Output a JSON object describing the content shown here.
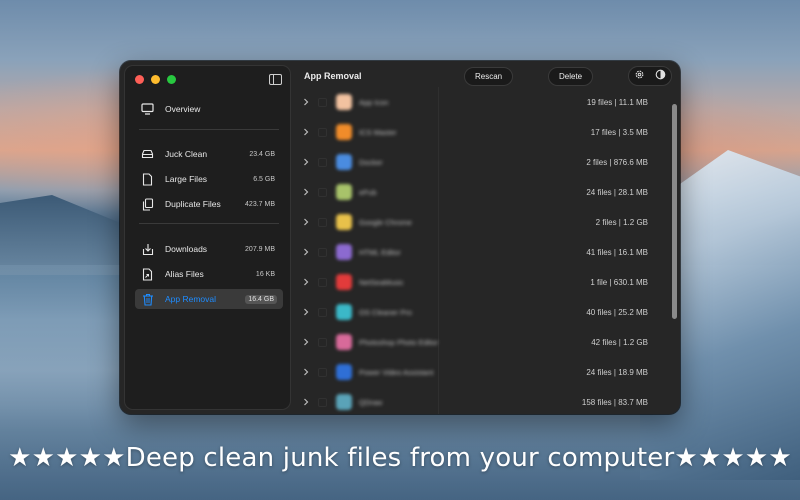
{
  "colors": {
    "accent": "#1e8cff",
    "window_bg": "#262626",
    "sidebar_bg": "#1e1e1e"
  },
  "window": {
    "traffic_lights": [
      "close",
      "minimize",
      "maximize"
    ],
    "sidebar": {
      "toggle_icon": "sidebar-toggle-icon",
      "items": [
        {
          "label": "Overview",
          "icon": "monitor-icon",
          "size": ""
        },
        {
          "label": "Juck Clean",
          "icon": "drive-icon",
          "size": "23.4 GB"
        },
        {
          "label": "Large Files",
          "icon": "document-icon",
          "size": "6.5 GB"
        },
        {
          "label": "Duplicate Files",
          "icon": "duplicate-icon",
          "size": "423.7 MB"
        },
        {
          "label": "Downloads",
          "icon": "download-icon",
          "size": "207.9 MB"
        },
        {
          "label": "Alias Files",
          "icon": "alias-file-icon",
          "size": "16 KB"
        },
        {
          "label": "App Removal",
          "icon": "trash-icon",
          "size": "16.4 GB",
          "selected": true
        }
      ]
    },
    "main": {
      "title": "App Removal",
      "rescan_label": "Rescan",
      "delete_label": "Delete",
      "tool_icons": [
        "gear-icon",
        "contrast-icon"
      ],
      "rows": [
        {
          "name": "App Icon",
          "info": "19 files | 11.1 MB",
          "icon_color": "#f2c2a0"
        },
        {
          "name": "ICS Master",
          "info": "17 files | 3.5 MB",
          "icon_color": "#f08c2a"
        },
        {
          "name": "Docker",
          "info": "2 files | 876.6 MB",
          "icon_color": "#4a8ce0"
        },
        {
          "name": "ePub",
          "info": "24 files | 28.1 MB",
          "icon_color": "#a8c36a"
        },
        {
          "name": "Google Chrome",
          "info": "2 files | 1.2 GB",
          "icon_color": "#e8c14a"
        },
        {
          "name": "HTML Editor",
          "info": "41 files | 16.1 MB",
          "icon_color": "#8c6ad0"
        },
        {
          "name": "NetSeaMusic",
          "info": "1 file | 630.1 MB",
          "icon_color": "#e23b3b"
        },
        {
          "name": "OS Cleaner Pro",
          "info": "40 files | 25.2 MB",
          "icon_color": "#3bb8c8"
        },
        {
          "name": "Photoshop Photo Editor",
          "info": "42 files | 1.2 GB",
          "icon_color": "#d86a9a"
        },
        {
          "name": "Power Video Assistant",
          "info": "24 files | 18.9 MB",
          "icon_color": "#2f6fd6"
        },
        {
          "name": "QDraw",
          "info": "158 files | 83.7 MB",
          "icon_color": "#5aa3b8"
        }
      ]
    }
  },
  "caption": "★★★★★Deep clean junk files from your computer★★★★★"
}
